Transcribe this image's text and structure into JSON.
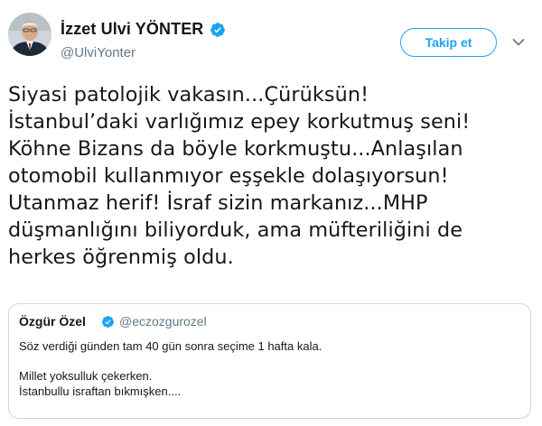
{
  "author": {
    "name": "İzzet Ulvi YÖNTER",
    "handle": "@UlviYonter",
    "verified_icon": "verified-badge-icon"
  },
  "actions": {
    "follow_label": "Takip et",
    "menu_icon": "chevron-down-icon"
  },
  "tweet": {
    "lines": [
      "Siyasi patolojik vakasın...Çürüksün!",
      "İstanbul’daki varlığımız epey korkutmuş seni!",
      "Köhne Bizans da böyle korkmuştu...Anlaşılan",
      "otomobil kullanmıyor eşşekle dolaşıyorsun!",
      "Utanmaz herif! İsraf sizin markanız...MHP",
      "düşmanlığını biliyorduk, ama müfteriliğini de",
      "herkes öğrenmiş oldu."
    ]
  },
  "quote": {
    "name": "Özgür Özel",
    "handle": "@eczozgurozel",
    "lines": [
      "Söz verdiği günden tam 40 gün sonra seçime 1 hafta kala.",
      "Millet yoksulluk çekerken.",
      "İstanbullu israftan bıkmışken...."
    ]
  },
  "colors": {
    "accent": "#1da1f2",
    "text": "#14171a",
    "muted": "#657786",
    "border": "#ccd6dd"
  }
}
